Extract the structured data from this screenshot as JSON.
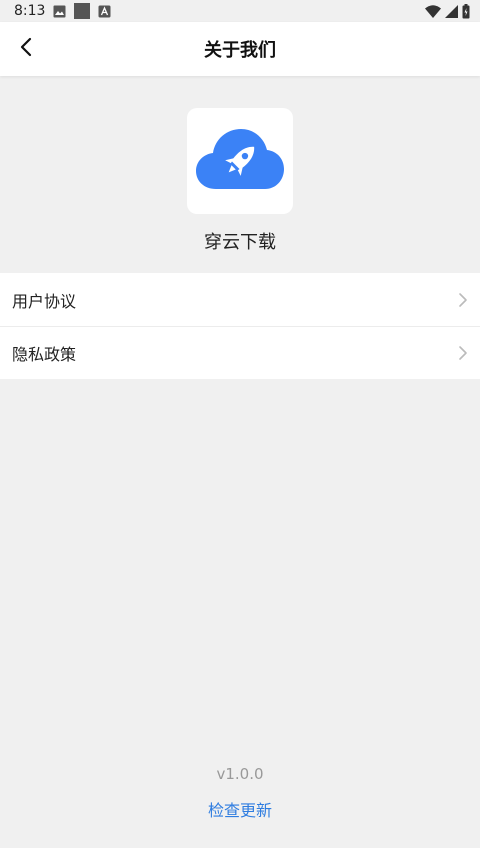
{
  "status_bar": {
    "time": "8:13",
    "icons": [
      "image-icon",
      "square-icon",
      "a-icon",
      "wifi-icon",
      "signal-icon",
      "battery-icon"
    ]
  },
  "header": {
    "title": "关于我们",
    "back_icon": "back-arrow-icon"
  },
  "app": {
    "name": "穿云下载",
    "logo": "cloud-rocket-logo",
    "brand_color": "#3b82f6"
  },
  "menu": {
    "items": [
      {
        "label": "用户协议"
      },
      {
        "label": "隐私政策"
      }
    ]
  },
  "footer": {
    "version": "v1.0.0",
    "check_update": "检查更新",
    "link_color": "#2f7de0"
  }
}
